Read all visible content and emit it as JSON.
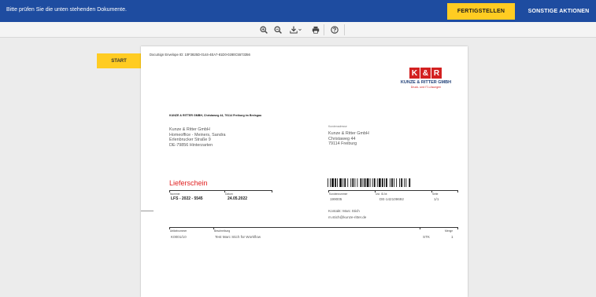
{
  "topbar": {
    "message": "Bitte prüfen Sie die unten stehenden Dokumente.",
    "finish_label": "FERTIGSTELLEN",
    "other_actions_label": "SONSTIGE AKTIONEN",
    "bar_color": "#1e4ca0",
    "accent_color": "#ffcc22"
  },
  "toolbar": {
    "icons": [
      "zoom-in-icon",
      "zoom-out-icon",
      "download-icon",
      "print-icon",
      "help-icon"
    ]
  },
  "sidebar": {
    "start_label": "START"
  },
  "document": {
    "envelope_id": "DocuSign Envelope ID: 10F3825D-0144-4EA7-81D0-0280C5573356",
    "logo": {
      "letter_k": "K",
      "ampersand": "&",
      "letter_r": "R",
      "company": "KUNZE & RITTER GMBH",
      "tagline": "Druck- und IT-Lösungen",
      "brand_color": "#d32020"
    },
    "sender_line": "KUNZE & RITTER GMBH, Christaweg 44, 79114 Freiburg im Breisgau",
    "recipient": {
      "line1": "Kunze & Ritter GmbH",
      "line2": "Homeoffice - Meiners, Sandra",
      "line3": "Erlenbrucker Straße 9",
      "line4": "DE-79856 Hinterzarten"
    },
    "supplier_label": "Kundenadresse",
    "supplier": {
      "line1": "Kunze & Ritter GmbH",
      "line2": "Christaweg 44",
      "line3": "79114 Freiburg"
    },
    "title": "Lieferschein",
    "number_label": "Nummer",
    "number": "LFS - 2022 - 5545",
    "date_label": "Datum",
    "date": "24.05.2022",
    "customer_no_label": "Kundennummer",
    "customer_no": "199005",
    "tax_id_label": "Ust. ID-Nr.",
    "tax_id": "DE-142109692",
    "page_label": "Seite",
    "page": "1/1",
    "contact_line": "Kontakt: Marc Stich",
    "contact_email": "m.stich@kunze-ritter.de",
    "table": {
      "col_article": "Artikelnummer",
      "col_description": "Beschreibung",
      "col_qty": "Menge",
      "row_article": "K0001/10",
      "row_description": "Test Marc Stich für Workflow",
      "row_unit": "STK",
      "row_qty": "1"
    }
  }
}
